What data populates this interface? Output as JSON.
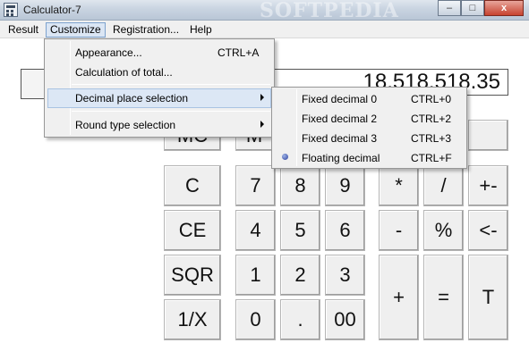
{
  "window": {
    "title": "Calculator-7",
    "watermark": "SOFTPEDIA"
  },
  "window_controls": {
    "minimize": "–",
    "maximize": "□",
    "close": "x"
  },
  "menubar": {
    "items": [
      "Result",
      "Customize",
      "Registration...",
      "Help"
    ]
  },
  "display": {
    "value": "18,518,518.35"
  },
  "customize_menu": {
    "items": [
      {
        "label": "Appearance...",
        "shortcut": "CTRL+A"
      },
      {
        "label": "Calculation of total...",
        "shortcut": ""
      },
      {
        "label": "Decimal place selection",
        "shortcut": ""
      },
      {
        "label": "Round type selection",
        "shortcut": ""
      }
    ]
  },
  "decimal_submenu": {
    "items": [
      {
        "label": "Fixed decimal 0",
        "shortcut": "CTRL+0",
        "selected": false
      },
      {
        "label": "Fixed decimal 2",
        "shortcut": "CTRL+2",
        "selected": false
      },
      {
        "label": "Fixed decimal 3",
        "shortcut": "CTRL+3",
        "selected": false
      },
      {
        "label": "Floating decimal",
        "shortcut": "CTRL+F",
        "selected": true
      }
    ]
  },
  "keypad": {
    "row0_partial": [
      "MC",
      "M"
    ],
    "keys": [
      "C",
      "7",
      "8",
      "9",
      "*",
      "/",
      "+-",
      "CE",
      "4",
      "5",
      "6",
      "-",
      "%",
      "<-",
      "SQR",
      "1",
      "2",
      "3",
      "+",
      "=",
      "T",
      "1/X",
      "0",
      ".",
      "00"
    ]
  },
  "colors": {
    "highlight": "#dce7f5",
    "menu_bg": "#f0f0f0",
    "key_bg": "#efefef"
  }
}
